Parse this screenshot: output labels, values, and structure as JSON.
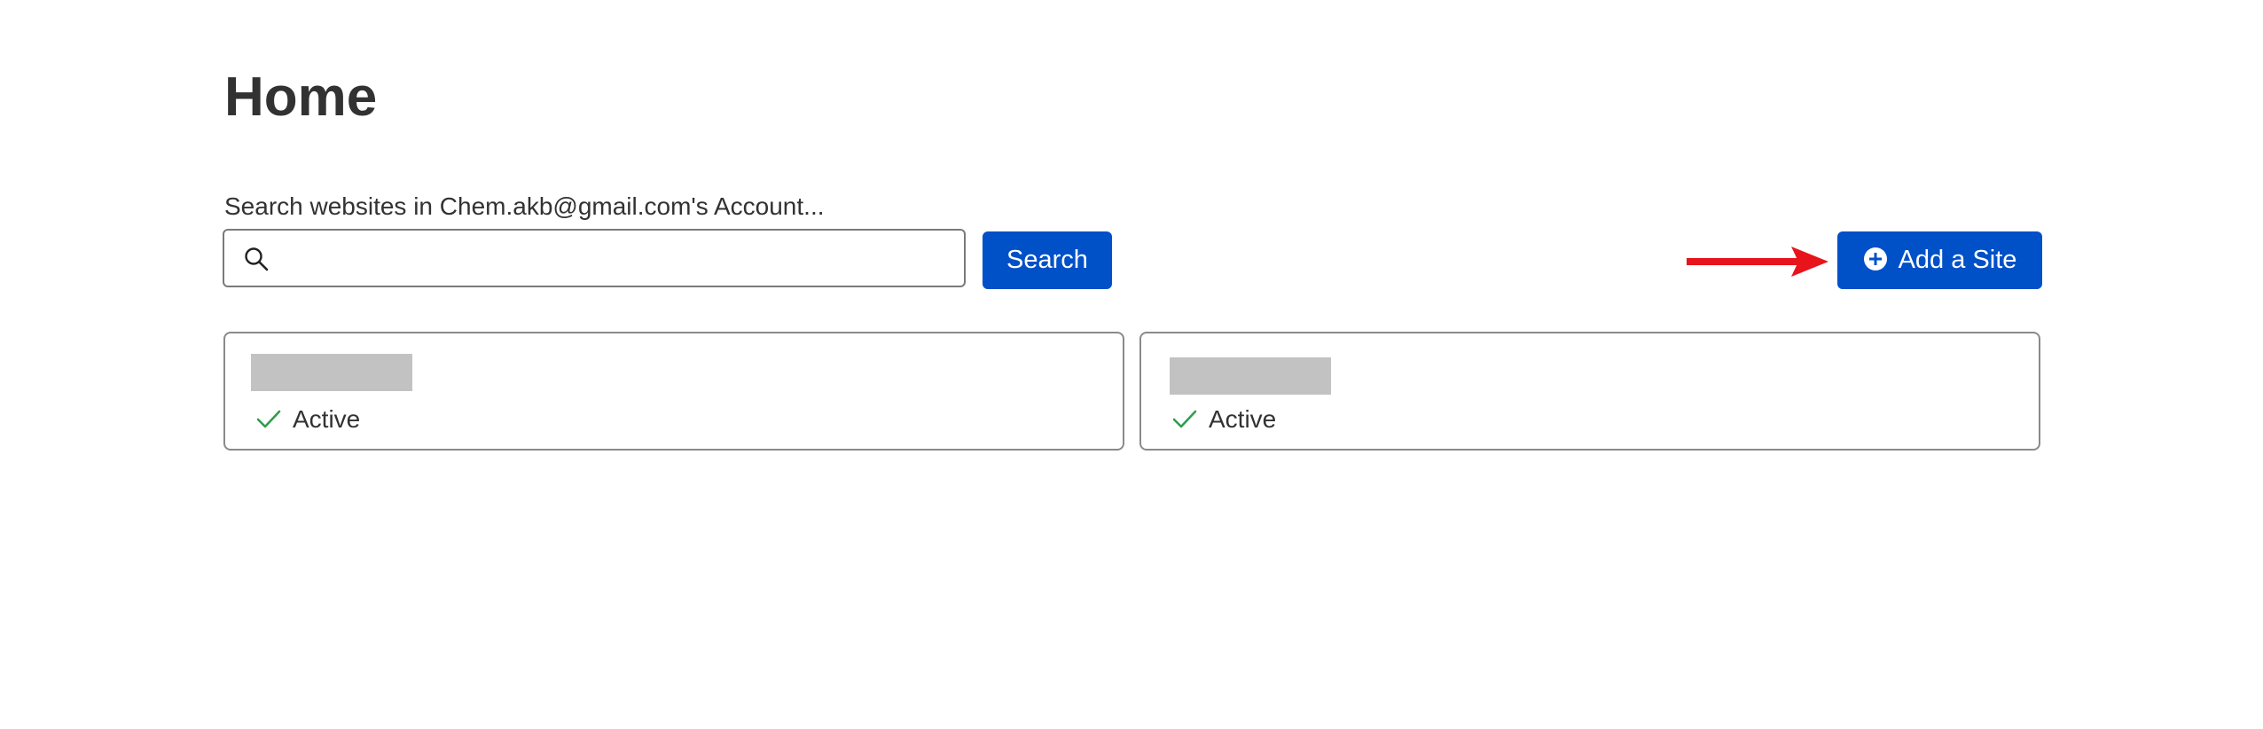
{
  "page": {
    "title": "Home"
  },
  "search": {
    "label": "Search websites in Chem.akb@gmail.com's Account...",
    "value": "",
    "placeholder": "",
    "button_label": "Search",
    "icon": "search-icon"
  },
  "actions": {
    "add_site_label": "Add a Site",
    "add_site_icon": "plus-circle-icon",
    "annotation_arrow_color": "#e8141c"
  },
  "sites": [
    {
      "name": "",
      "name_redacted": true,
      "status": "Active",
      "status_icon": "checkmark-icon"
    },
    {
      "name": "",
      "name_redacted": true,
      "status": "Active",
      "status_icon": "checkmark-icon"
    }
  ],
  "colors": {
    "primary": "#0050c8",
    "success": "#2e9e4f",
    "text": "#323232",
    "redaction": "#c2c2c2"
  }
}
